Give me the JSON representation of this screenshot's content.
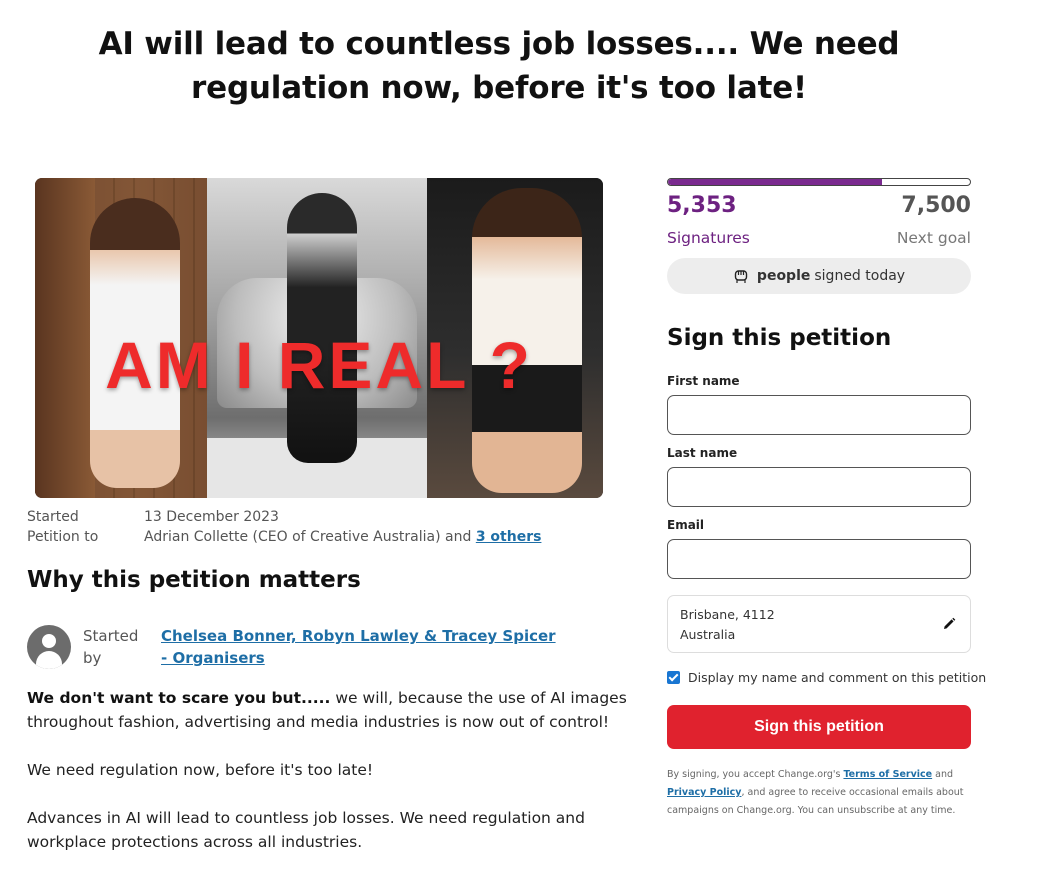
{
  "headline": "AI will lead to countless job losses.... We need regulation now, before it's too late!",
  "hero_image": {
    "overlay_text": "AM I REAL ?"
  },
  "meta": {
    "started_label": "Started",
    "started_value": "13 December 2023",
    "petition_to_label": "Petition to",
    "petition_to_value": "Adrian Collette (CEO of Creative Australia) and",
    "others_link": "3 others"
  },
  "why_heading": "Why this petition matters",
  "starter": {
    "label": "Started by",
    "organisers": "Chelsea Bonner, Robyn Lawley & Tracey Spicer - Organisers"
  },
  "story": {
    "p1_bold": "We don't want to scare you but.....",
    "p1_rest": " we will, because the use of AI images throughout fashion, advertising and media industries is now out of control!",
    "p2": "We need regulation now, before it's too late!",
    "p3": "Advances in AI will lead to countless job losses. We need regulation and workplace protections across all industries."
  },
  "progress": {
    "signatures": "5,353",
    "signatures_label": "Signatures",
    "goal": "7,500",
    "goal_label": "Next goal",
    "fraction": 0.71,
    "fill_color": "#7a2a8f"
  },
  "today": {
    "icon": "raised-fist-icon",
    "bold": "people",
    "rest": "signed today"
  },
  "form": {
    "title": "Sign this petition",
    "first_name_label": "First name",
    "last_name_label": "Last name",
    "email_label": "Email",
    "location_line1": "Brisbane, 4112",
    "location_line2": "Australia",
    "display_checkbox_label": "Display my name and comment on this petition",
    "display_checked": true,
    "submit_label": "Sign this petition",
    "submit_color": "#e0222e"
  },
  "legal": {
    "pre": "By signing, you accept Change.org's ",
    "terms": "Terms of Service",
    "mid": " and ",
    "privacy": "Privacy Policy",
    "post": ", and agree to receive occasional emails about campaigns on Change.org. You can unsubscribe at any time."
  }
}
